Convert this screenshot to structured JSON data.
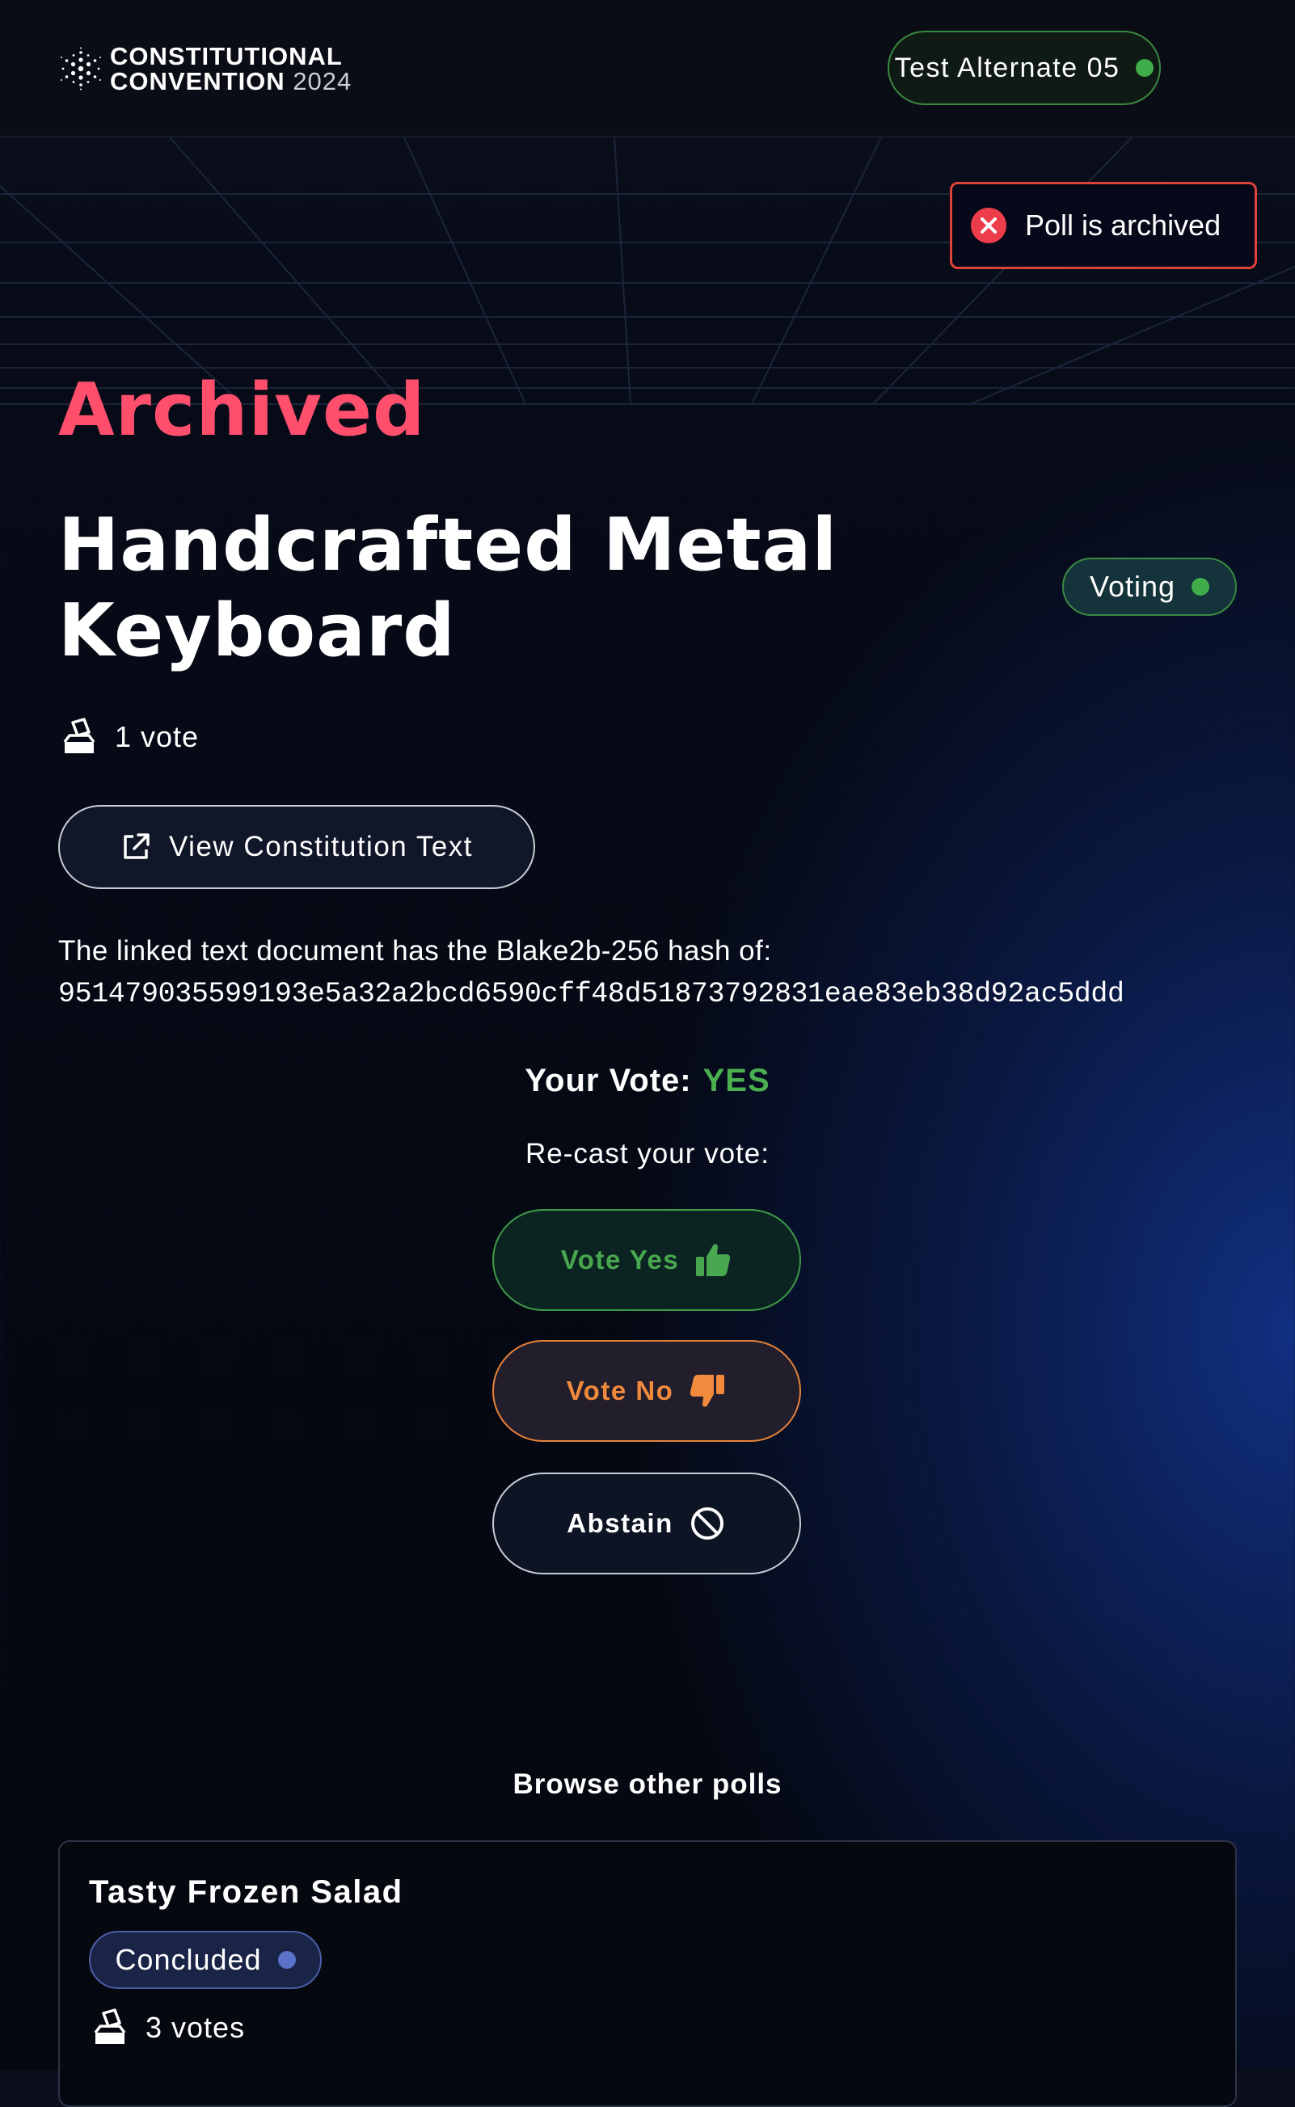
{
  "header": {
    "logo_line1": "CONSTITUTIONAL",
    "logo_line2": "CONVENTION",
    "logo_year": "2024",
    "user_name": "Test Alternate 05",
    "logo_icon": "cardano-logo-icon"
  },
  "toast": {
    "message": "Poll is archived",
    "icon": "error-x-icon",
    "color": "#e0413a"
  },
  "poll": {
    "state": "Archived",
    "title": "Handcrafted Metal Keyboard",
    "status": "Voting",
    "vote_count": "1 vote",
    "view_button": "View Constitution Text",
    "hash_label": "The linked text document has the Blake2b-256 hash of:",
    "hash_value": "951479035599193e5a32a2bcd6590cff48d51873792831eae83eb38d92ac5ddd",
    "your_vote_label": "Your Vote:",
    "your_vote_value": "YES",
    "recast_label": "Re-cast your vote:"
  },
  "vote_buttons": {
    "yes": "Vote Yes",
    "no": "Vote No",
    "abstain": "Abstain"
  },
  "browse": {
    "heading": "Browse other polls",
    "polls": [
      {
        "title": "Tasty Frozen Salad",
        "status": "Concluded",
        "votes": "3 votes"
      }
    ]
  },
  "colors": {
    "archived": "#ff4f6d",
    "yes": "#4caf50",
    "no": "#f18a3c",
    "status_green": "#3fae4a",
    "status_blue": "#5b72c9"
  }
}
